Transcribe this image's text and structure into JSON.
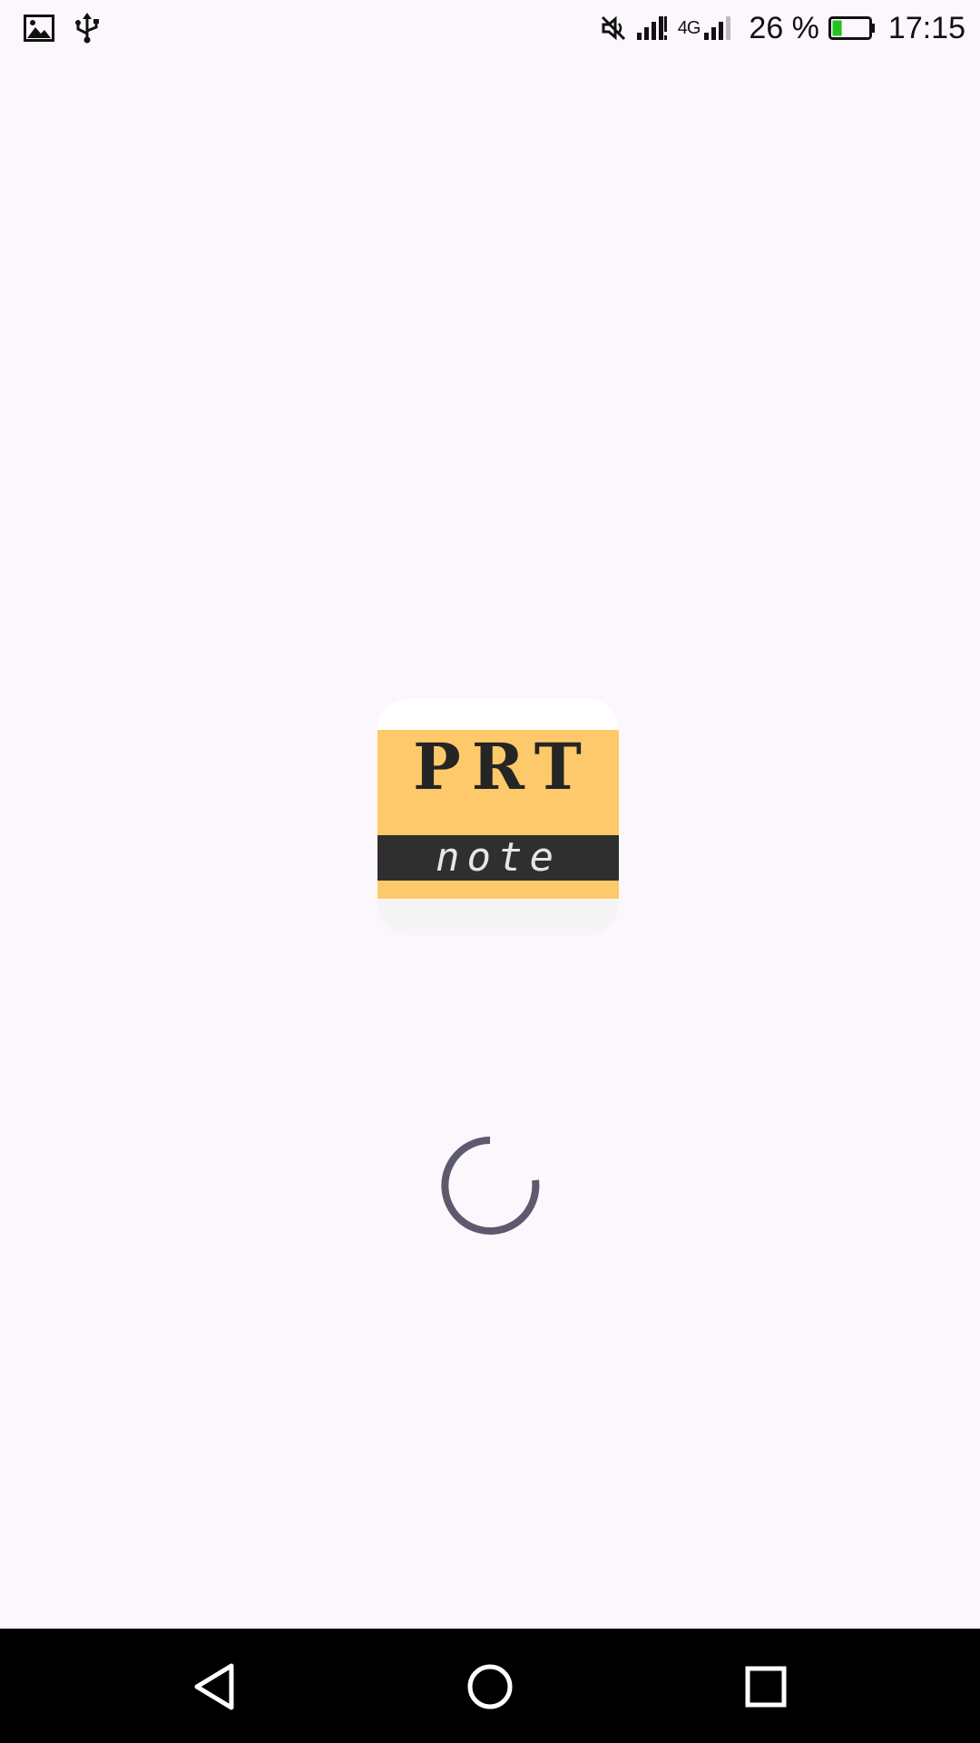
{
  "status_bar": {
    "left_icons": [
      "image-icon",
      "usb-icon"
    ],
    "right_icons": [
      "mute-icon",
      "signal-icon",
      "signal-4g-icon",
      "battery-icon"
    ],
    "network_label": "4G",
    "battery_percent": "26 %",
    "battery_level": 0.26,
    "battery_color": "#22c322",
    "time": "17:15"
  },
  "splash": {
    "logo": {
      "title": "PRT",
      "subtitle": "note",
      "colors": {
        "yellow": "#fec96a",
        "band": "#2f2f2f"
      }
    },
    "spinner_icon": "loading-spinner",
    "spinner_color": "#5e5a6e"
  },
  "nav_bar": {
    "buttons": [
      "back-icon",
      "home-icon",
      "recents-icon"
    ]
  }
}
